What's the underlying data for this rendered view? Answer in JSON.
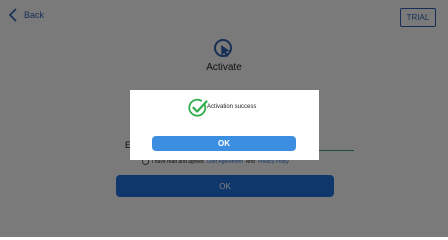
{
  "header": {
    "back_label": "Back",
    "trial_label": "TRIAL"
  },
  "main": {
    "title": "Activate",
    "field_label_visible": "E",
    "agreement": {
      "prefix": "I have read and agreed",
      "link1": "User Agreement",
      "middle": "And",
      "link2": "Privacy Policy"
    },
    "ok_label": "OK"
  },
  "dialog": {
    "message": "Activation success",
    "ok_label": "OK"
  },
  "colors": {
    "accent": "#2f5fa8",
    "success_green": "#2fae4b",
    "dialog_button": "#3b8ee0",
    "main_button": "#1f6ed8"
  },
  "icons": {
    "back": "chevron-left-icon",
    "activate": "cursor-target-icon",
    "success": "check-circle-icon"
  }
}
